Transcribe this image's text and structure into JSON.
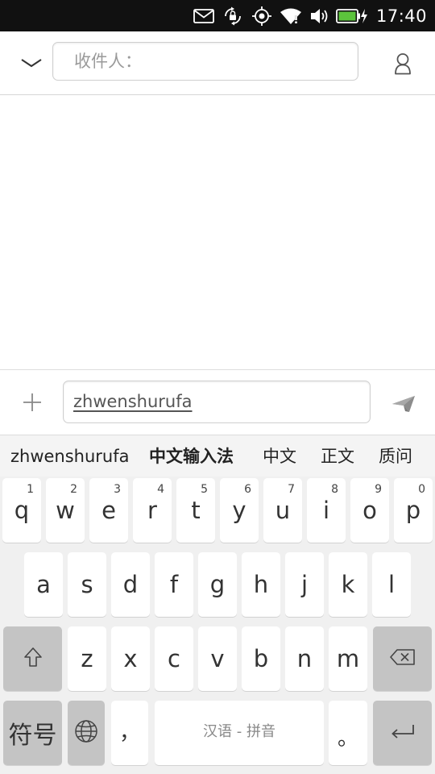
{
  "status_bar": {
    "icons": [
      "mail-icon",
      "screen-rotation-lock-icon",
      "location-icon",
      "wifi-icon",
      "volume-icon",
      "battery-charging-icon"
    ],
    "time": "17:40"
  },
  "header": {
    "recipient_placeholder": "收件人："
  },
  "compose": {
    "message_text": "zhwenshurufa"
  },
  "candidates": [
    {
      "text": "zhwenshurufa",
      "bold": false
    },
    {
      "text": "中文输入法",
      "bold": true
    },
    {
      "text": "中文",
      "bold": false
    },
    {
      "text": "正文",
      "bold": false
    },
    {
      "text": "质问",
      "bold": false
    }
  ],
  "keyboard": {
    "row1": [
      {
        "key": "q",
        "num": "1"
      },
      {
        "key": "w",
        "num": "2"
      },
      {
        "key": "e",
        "num": "3"
      },
      {
        "key": "r",
        "num": "4"
      },
      {
        "key": "t",
        "num": "5"
      },
      {
        "key": "y",
        "num": "6"
      },
      {
        "key": "u",
        "num": "7"
      },
      {
        "key": "i",
        "num": "8"
      },
      {
        "key": "o",
        "num": "9"
      },
      {
        "key": "p",
        "num": "0"
      }
    ],
    "row2": [
      "a",
      "s",
      "d",
      "f",
      "g",
      "h",
      "j",
      "k",
      "l"
    ],
    "row3": [
      "z",
      "x",
      "c",
      "v",
      "b",
      "n",
      "m"
    ],
    "symbols_label": "符号",
    "comma_label": "，",
    "space_label": "汉语 - 拼音",
    "period_label": "。"
  },
  "colors": {
    "status_bar_bg": "#111111",
    "keyboard_bg": "#f0f0f0",
    "key_bg": "#ffffff",
    "special_key_bg": "#c4c4c4",
    "battery_fill": "#5cc43c"
  }
}
